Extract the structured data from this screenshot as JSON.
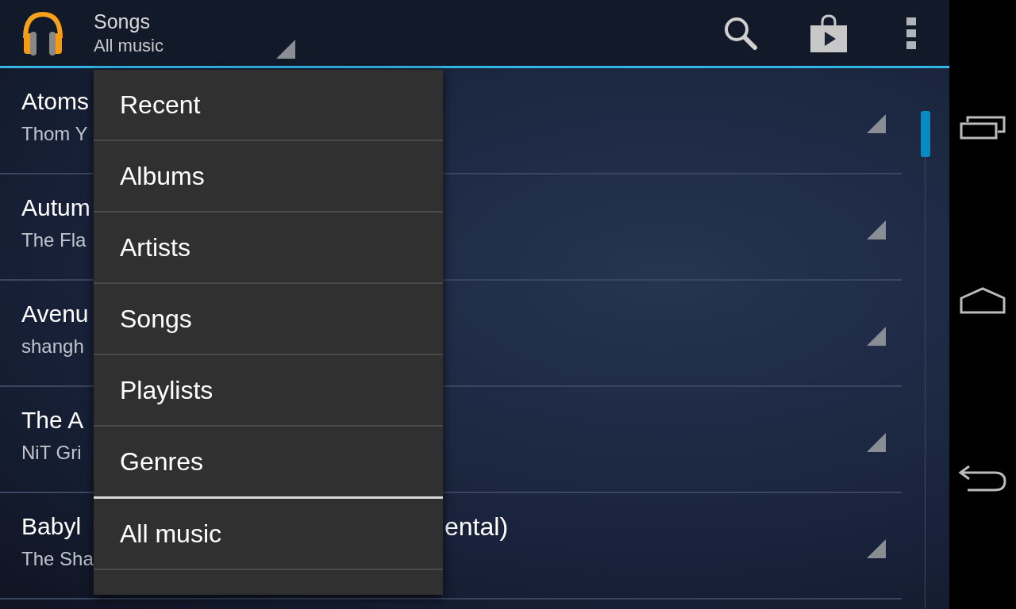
{
  "action_bar": {
    "title": "Songs",
    "subtitle": "All music"
  },
  "songs": [
    {
      "title": "Atoms",
      "artist": "Thom Y"
    },
    {
      "title": "Autum",
      "artist": "The Fla"
    },
    {
      "title": "Avenu",
      "artist": "shangh"
    },
    {
      "title": "The A",
      "artist": "NiT Gri"
    },
    {
      "title": "Babyl",
      "title_right": "ental)",
      "artist": "The Sha"
    }
  ],
  "dropdown": {
    "items": [
      {
        "kind": "item",
        "label": "Recent"
      },
      {
        "kind": "item",
        "label": "Albums"
      },
      {
        "kind": "item",
        "label": "Artists"
      },
      {
        "kind": "item",
        "label": "Songs"
      },
      {
        "kind": "item",
        "label": "Playlists"
      },
      {
        "kind": "item",
        "label": "Genres"
      },
      {
        "kind": "group-divider"
      },
      {
        "kind": "item",
        "label": "All music"
      },
      {
        "kind": "cut-item"
      }
    ]
  }
}
